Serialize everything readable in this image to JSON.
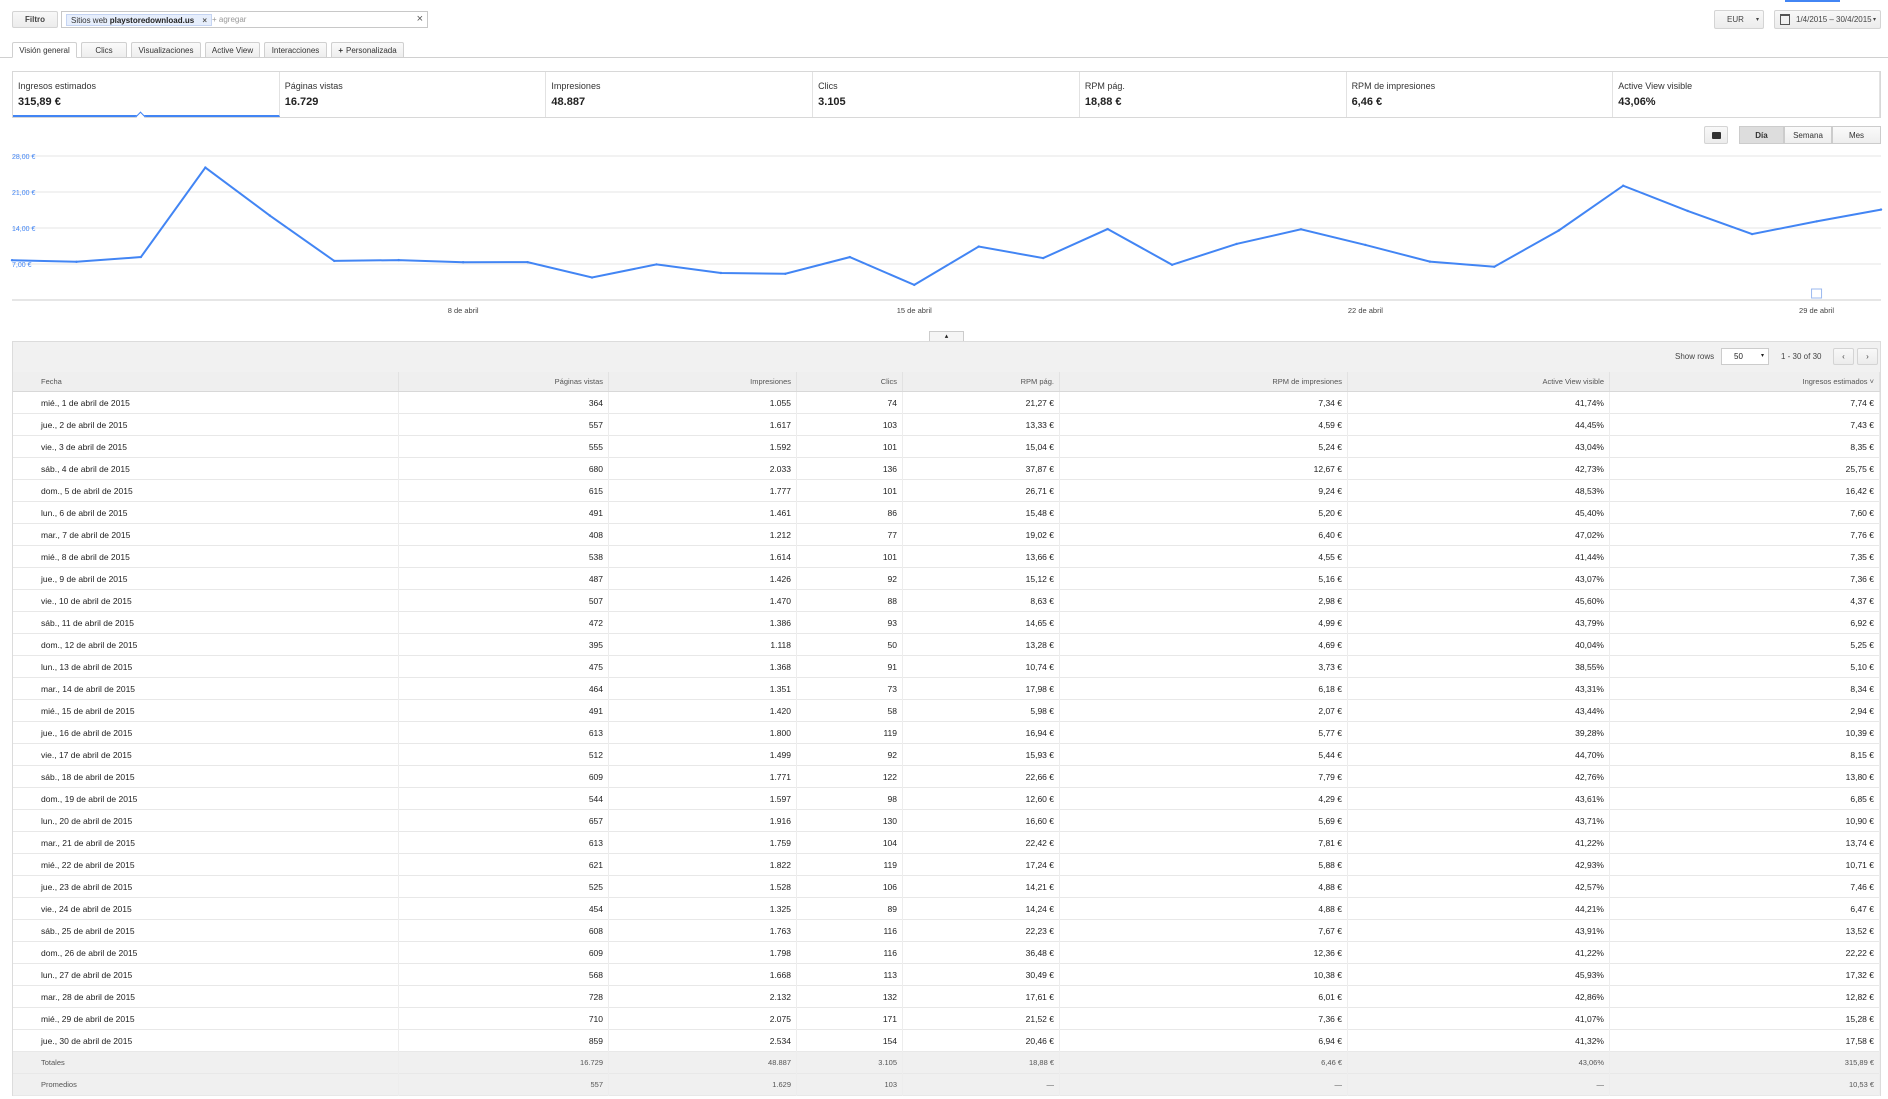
{
  "filter": {
    "button_label": "Filtro",
    "chip_prefix": "Sitios web",
    "chip_value": "playstoredownload.us",
    "placeholder": "+ agregar"
  },
  "top_right": {
    "currency": "EUR",
    "date_range": "1/4/2015 – 30/4/2015"
  },
  "tabs": [
    {
      "label": "Visión general",
      "active": true
    },
    {
      "label": "Clics"
    },
    {
      "label": "Visualizaciones"
    },
    {
      "label": "Active View"
    },
    {
      "label": "Interacciones"
    },
    {
      "label": "Personalizada",
      "icon": "plus-icon"
    }
  ],
  "metrics": [
    {
      "label": "Ingresos estimados",
      "value": "315,89 €",
      "selected": true
    },
    {
      "label": "Páginas vistas",
      "value": "16.729"
    },
    {
      "label": "Impresiones",
      "value": "48.887"
    },
    {
      "label": "Clics",
      "value": "3.105"
    },
    {
      "label": "RPM pág.",
      "value": "18,88 €"
    },
    {
      "label": "RPM de impresiones",
      "value": "6,46 €"
    },
    {
      "label": "Active View visible",
      "value": "43,06%"
    }
  ],
  "granularity": {
    "options": [
      "Día",
      "Semana",
      "Mes"
    ],
    "selected": "Día"
  },
  "chart_data": {
    "type": "line",
    "x": [
      "1/4",
      "2/4",
      "3/4",
      "4/4",
      "5/4",
      "6/4",
      "7/4",
      "8/4",
      "9/4",
      "10/4",
      "11/4",
      "12/4",
      "13/4",
      "14/4",
      "15/4",
      "16/4",
      "17/4",
      "18/4",
      "19/4",
      "20/4",
      "21/4",
      "22/4",
      "23/4",
      "24/4",
      "25/4",
      "26/4",
      "27/4",
      "28/4",
      "29/4",
      "30/4"
    ],
    "series": [
      {
        "values": [
          7.74,
          7.43,
          8.35,
          25.75,
          16.42,
          7.6,
          7.76,
          7.35,
          7.36,
          4.37,
          6.92,
          5.25,
          5.1,
          8.34,
          2.94,
          10.39,
          8.15,
          13.8,
          6.85,
          10.9,
          13.74,
          10.71,
          7.46,
          6.47,
          13.52,
          22.22,
          17.32,
          12.82,
          15.28,
          17.58
        ]
      }
    ],
    "ylim": [
      0,
      28
    ],
    "ytick_labels": [
      "7,00 €",
      "14,00 €",
      "21,00 €",
      "28,00 €"
    ],
    "ytick_values": [
      7,
      14,
      21,
      28
    ],
    "xtick_labels": [
      "8 de abril",
      "15 de abril",
      "22 de abril",
      "29 de abril"
    ],
    "xtick_indices": [
      7,
      14,
      21,
      28
    ],
    "grid": true,
    "color": "#4285f4"
  },
  "table": {
    "show_rows_label": "Show rows",
    "rows_value": "50",
    "pagination": "1 - 30 of 30",
    "columns": [
      "Fecha",
      "Páginas vistas",
      "Impresiones",
      "Clics",
      "RPM pág.",
      "RPM de impresiones",
      "Active View visible",
      "Ingresos estimados ˅"
    ],
    "rows": [
      [
        "mié., 1 de abril de 2015",
        "364",
        "1.055",
        "74",
        "21,27 €",
        "7,34 €",
        "41,74%",
        "7,74 €"
      ],
      [
        "jue., 2 de abril de 2015",
        "557",
        "1.617",
        "103",
        "13,33 €",
        "4,59 €",
        "44,45%",
        "7,43 €"
      ],
      [
        "vie., 3 de abril de 2015",
        "555",
        "1.592",
        "101",
        "15,04 €",
        "5,24 €",
        "43,04%",
        "8,35 €"
      ],
      [
        "sáb., 4 de abril de 2015",
        "680",
        "2.033",
        "136",
        "37,87 €",
        "12,67 €",
        "42,73%",
        "25,75 €"
      ],
      [
        "dom., 5 de abril de 2015",
        "615",
        "1.777",
        "101",
        "26,71 €",
        "9,24 €",
        "48,53%",
        "16,42 €"
      ],
      [
        "lun., 6 de abril de 2015",
        "491",
        "1.461",
        "86",
        "15,48 €",
        "5,20 €",
        "45,40%",
        "7,60 €"
      ],
      [
        "mar., 7 de abril de 2015",
        "408",
        "1.212",
        "77",
        "19,02 €",
        "6,40 €",
        "47,02%",
        "7,76 €"
      ],
      [
        "mié., 8 de abril de 2015",
        "538",
        "1.614",
        "101",
        "13,66 €",
        "4,55 €",
        "41,44%",
        "7,35 €"
      ],
      [
        "jue., 9 de abril de 2015",
        "487",
        "1.426",
        "92",
        "15,12 €",
        "5,16 €",
        "43,07%",
        "7,36 €"
      ],
      [
        "vie., 10 de abril de 2015",
        "507",
        "1.470",
        "88",
        "8,63 €",
        "2,98 €",
        "45,60%",
        "4,37 €"
      ],
      [
        "sáb., 11 de abril de 2015",
        "472",
        "1.386",
        "93",
        "14,65 €",
        "4,99 €",
        "43,79%",
        "6,92 €"
      ],
      [
        "dom., 12 de abril de 2015",
        "395",
        "1.118",
        "50",
        "13,28 €",
        "4,69 €",
        "40,04%",
        "5,25 €"
      ],
      [
        "lun., 13 de abril de 2015",
        "475",
        "1.368",
        "91",
        "10,74 €",
        "3,73 €",
        "38,55%",
        "5,10 €"
      ],
      [
        "mar., 14 de abril de 2015",
        "464",
        "1.351",
        "73",
        "17,98 €",
        "6,18 €",
        "43,31%",
        "8,34 €"
      ],
      [
        "mié., 15 de abril de 2015",
        "491",
        "1.420",
        "58",
        "5,98 €",
        "2,07 €",
        "43,44%",
        "2,94 €"
      ],
      [
        "jue., 16 de abril de 2015",
        "613",
        "1.800",
        "119",
        "16,94 €",
        "5,77 €",
        "39,28%",
        "10,39 €"
      ],
      [
        "vie., 17 de abril de 2015",
        "512",
        "1.499",
        "92",
        "15,93 €",
        "5,44 €",
        "44,70%",
        "8,15 €"
      ],
      [
        "sáb., 18 de abril de 2015",
        "609",
        "1.771",
        "122",
        "22,66 €",
        "7,79 €",
        "42,76%",
        "13,80 €"
      ],
      [
        "dom., 19 de abril de 2015",
        "544",
        "1.597",
        "98",
        "12,60 €",
        "4,29 €",
        "43,61%",
        "6,85 €"
      ],
      [
        "lun., 20 de abril de 2015",
        "657",
        "1.916",
        "130",
        "16,60 €",
        "5,69 €",
        "43,71%",
        "10,90 €"
      ],
      [
        "mar., 21 de abril de 2015",
        "613",
        "1.759",
        "104",
        "22,42 €",
        "7,81 €",
        "41,22%",
        "13,74 €"
      ],
      [
        "mié., 22 de abril de 2015",
        "621",
        "1.822",
        "119",
        "17,24 €",
        "5,88 €",
        "42,93%",
        "10,71 €"
      ],
      [
        "jue., 23 de abril de 2015",
        "525",
        "1.528",
        "106",
        "14,21 €",
        "4,88 €",
        "42,57%",
        "7,46 €"
      ],
      [
        "vie., 24 de abril de 2015",
        "454",
        "1.325",
        "89",
        "14,24 €",
        "4,88 €",
        "44,21%",
        "6,47 €"
      ],
      [
        "sáb., 25 de abril de 2015",
        "608",
        "1.763",
        "116",
        "22,23 €",
        "7,67 €",
        "43,91%",
        "13,52 €"
      ],
      [
        "dom., 26 de abril de 2015",
        "609",
        "1.798",
        "116",
        "36,48 €",
        "12,36 €",
        "41,22%",
        "22,22 €"
      ],
      [
        "lun., 27 de abril de 2015",
        "568",
        "1.668",
        "113",
        "30,49 €",
        "10,38 €",
        "45,93%",
        "17,32 €"
      ],
      [
        "mar., 28 de abril de 2015",
        "728",
        "2.132",
        "132",
        "17,61 €",
        "6,01 €",
        "42,86%",
        "12,82 €"
      ],
      [
        "mié., 29 de abril de 2015",
        "710",
        "2.075",
        "171",
        "21,52 €",
        "7,36 €",
        "41,07%",
        "15,28 €"
      ],
      [
        "jue., 30 de abril de 2015",
        "859",
        "2.534",
        "154",
        "20,46 €",
        "6,94 €",
        "41,32%",
        "17,58 €"
      ]
    ],
    "totals": [
      "Totales",
      "16.729",
      "48.887",
      "3.105",
      "18,88 €",
      "6,46 €",
      "43,06%",
      "315,89 €"
    ],
    "averages": [
      "Promedios",
      "557",
      "1.629",
      "103",
      "—",
      "—",
      "—",
      "10,53 €"
    ]
  }
}
